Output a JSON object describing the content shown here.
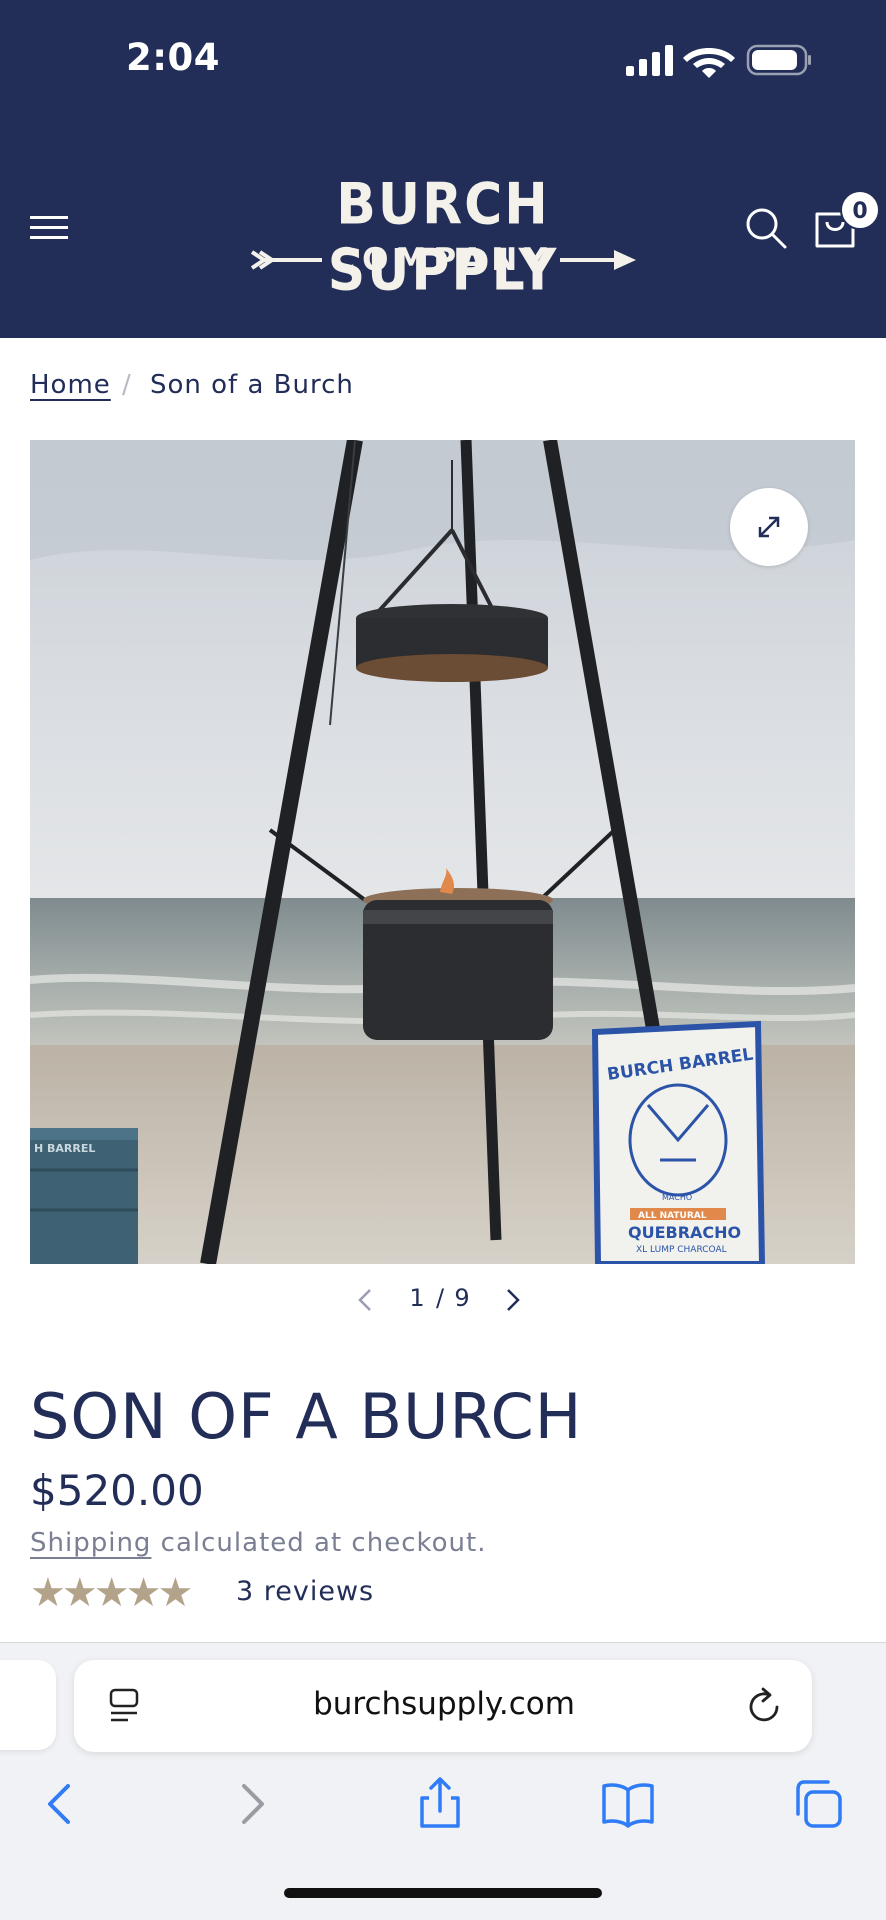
{
  "status_bar": {
    "time": "2:04"
  },
  "header": {
    "logo_line1": "BURCH SUPPLY",
    "logo_line2": "COMPANY",
    "cart_count": "0",
    "background_color": "#222e58"
  },
  "breadcrumb": {
    "home": "Home",
    "separator": "/",
    "current": "Son of a Burch"
  },
  "gallery": {
    "current": "1",
    "separator": "/",
    "total": "9",
    "bag_brand": "BURCH BARREL",
    "bag_product": "QUEBRACHO",
    "bag_sub": "XL LUMP CHARCOAL",
    "bag_tag": "ALL NATURAL",
    "bag_mascot": "MACHO",
    "crate_label": "H BARREL"
  },
  "product": {
    "title": "SON OF A BURCH",
    "price": "$520.00",
    "shipping_link": "Shipping",
    "shipping_rest": " calculated at checkout.",
    "rating": 5,
    "stars": "★★★★★",
    "reviews": "3 reviews"
  },
  "browser": {
    "url": "burchsupply.com"
  },
  "colors": {
    "brand_navy": "#222e58",
    "star_tan": "#b4a38b",
    "ios_blue": "#2f7cf6"
  }
}
